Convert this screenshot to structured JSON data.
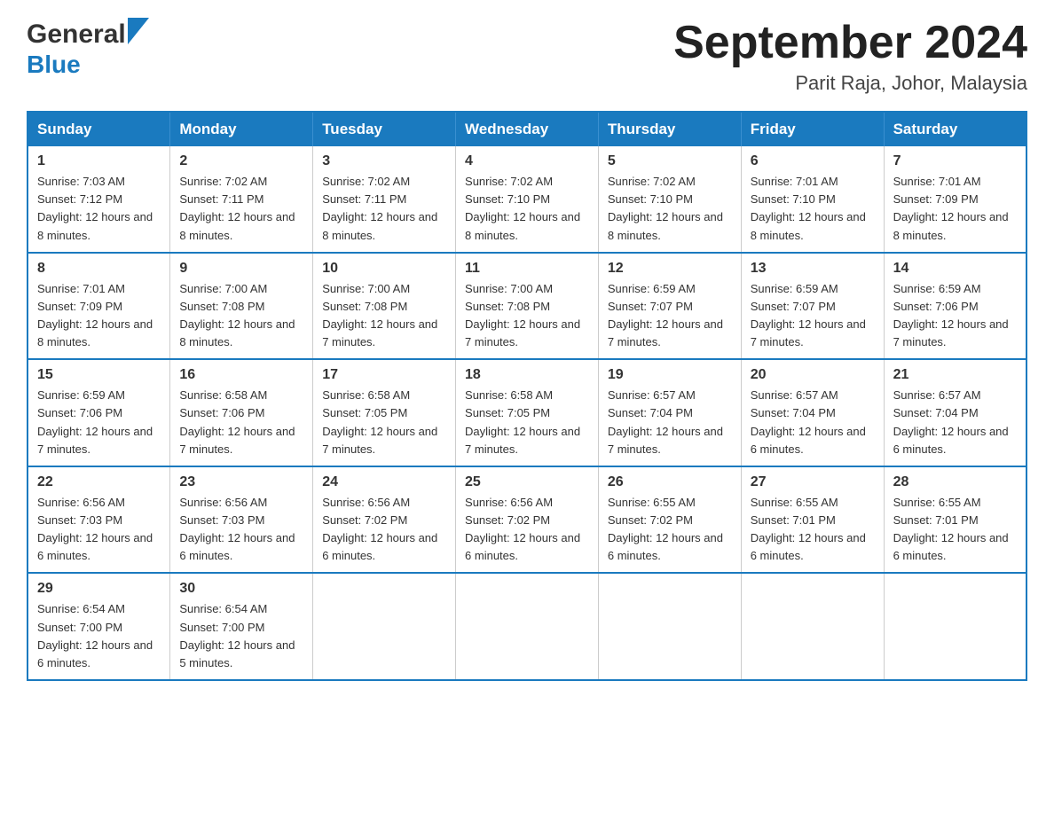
{
  "header": {
    "logo_general": "General",
    "logo_blue": "Blue",
    "month_title": "September 2024",
    "location": "Parit Raja, Johor, Malaysia"
  },
  "weekdays": [
    "Sunday",
    "Monday",
    "Tuesday",
    "Wednesday",
    "Thursday",
    "Friday",
    "Saturday"
  ],
  "weeks": [
    [
      {
        "day": "1",
        "sunrise": "7:03 AM",
        "sunset": "7:12 PM",
        "daylight": "12 hours and 8 minutes."
      },
      {
        "day": "2",
        "sunrise": "7:02 AM",
        "sunset": "7:11 PM",
        "daylight": "12 hours and 8 minutes."
      },
      {
        "day": "3",
        "sunrise": "7:02 AM",
        "sunset": "7:11 PM",
        "daylight": "12 hours and 8 minutes."
      },
      {
        "day": "4",
        "sunrise": "7:02 AM",
        "sunset": "7:10 PM",
        "daylight": "12 hours and 8 minutes."
      },
      {
        "day": "5",
        "sunrise": "7:02 AM",
        "sunset": "7:10 PM",
        "daylight": "12 hours and 8 minutes."
      },
      {
        "day": "6",
        "sunrise": "7:01 AM",
        "sunset": "7:10 PM",
        "daylight": "12 hours and 8 minutes."
      },
      {
        "day": "7",
        "sunrise": "7:01 AM",
        "sunset": "7:09 PM",
        "daylight": "12 hours and 8 minutes."
      }
    ],
    [
      {
        "day": "8",
        "sunrise": "7:01 AM",
        "sunset": "7:09 PM",
        "daylight": "12 hours and 8 minutes."
      },
      {
        "day": "9",
        "sunrise": "7:00 AM",
        "sunset": "7:08 PM",
        "daylight": "12 hours and 8 minutes."
      },
      {
        "day": "10",
        "sunrise": "7:00 AM",
        "sunset": "7:08 PM",
        "daylight": "12 hours and 7 minutes."
      },
      {
        "day": "11",
        "sunrise": "7:00 AM",
        "sunset": "7:08 PM",
        "daylight": "12 hours and 7 minutes."
      },
      {
        "day": "12",
        "sunrise": "6:59 AM",
        "sunset": "7:07 PM",
        "daylight": "12 hours and 7 minutes."
      },
      {
        "day": "13",
        "sunrise": "6:59 AM",
        "sunset": "7:07 PM",
        "daylight": "12 hours and 7 minutes."
      },
      {
        "day": "14",
        "sunrise": "6:59 AM",
        "sunset": "7:06 PM",
        "daylight": "12 hours and 7 minutes."
      }
    ],
    [
      {
        "day": "15",
        "sunrise": "6:59 AM",
        "sunset": "7:06 PM",
        "daylight": "12 hours and 7 minutes."
      },
      {
        "day": "16",
        "sunrise": "6:58 AM",
        "sunset": "7:06 PM",
        "daylight": "12 hours and 7 minutes."
      },
      {
        "day": "17",
        "sunrise": "6:58 AM",
        "sunset": "7:05 PM",
        "daylight": "12 hours and 7 minutes."
      },
      {
        "day": "18",
        "sunrise": "6:58 AM",
        "sunset": "7:05 PM",
        "daylight": "12 hours and 7 minutes."
      },
      {
        "day": "19",
        "sunrise": "6:57 AM",
        "sunset": "7:04 PM",
        "daylight": "12 hours and 7 minutes."
      },
      {
        "day": "20",
        "sunrise": "6:57 AM",
        "sunset": "7:04 PM",
        "daylight": "12 hours and 6 minutes."
      },
      {
        "day": "21",
        "sunrise": "6:57 AM",
        "sunset": "7:04 PM",
        "daylight": "12 hours and 6 minutes."
      }
    ],
    [
      {
        "day": "22",
        "sunrise": "6:56 AM",
        "sunset": "7:03 PM",
        "daylight": "12 hours and 6 minutes."
      },
      {
        "day": "23",
        "sunrise": "6:56 AM",
        "sunset": "7:03 PM",
        "daylight": "12 hours and 6 minutes."
      },
      {
        "day": "24",
        "sunrise": "6:56 AM",
        "sunset": "7:02 PM",
        "daylight": "12 hours and 6 minutes."
      },
      {
        "day": "25",
        "sunrise": "6:56 AM",
        "sunset": "7:02 PM",
        "daylight": "12 hours and 6 minutes."
      },
      {
        "day": "26",
        "sunrise": "6:55 AM",
        "sunset": "7:02 PM",
        "daylight": "12 hours and 6 minutes."
      },
      {
        "day": "27",
        "sunrise": "6:55 AM",
        "sunset": "7:01 PM",
        "daylight": "12 hours and 6 minutes."
      },
      {
        "day": "28",
        "sunrise": "6:55 AM",
        "sunset": "7:01 PM",
        "daylight": "12 hours and 6 minutes."
      }
    ],
    [
      {
        "day": "29",
        "sunrise": "6:54 AM",
        "sunset": "7:00 PM",
        "daylight": "12 hours and 6 minutes."
      },
      {
        "day": "30",
        "sunrise": "6:54 AM",
        "sunset": "7:00 PM",
        "daylight": "12 hours and 5 minutes."
      },
      null,
      null,
      null,
      null,
      null
    ]
  ]
}
